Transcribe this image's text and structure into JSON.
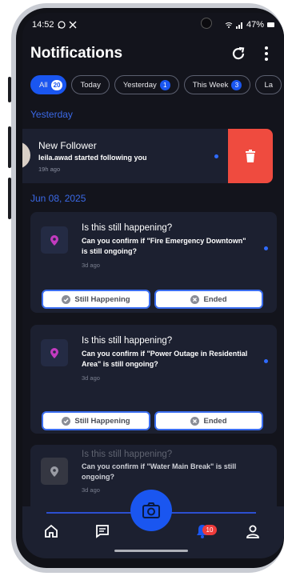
{
  "status_bar": {
    "time": "14:52",
    "right_text": "47%"
  },
  "header": {
    "title": "Notifications"
  },
  "filters": [
    {
      "label": "All",
      "count": "20"
    },
    {
      "label": "Today",
      "count": ""
    },
    {
      "label": "Yesterday",
      "count": "1"
    },
    {
      "label": "This Week",
      "count": "3"
    },
    {
      "label": "La",
      "count": ""
    }
  ],
  "sections": {
    "yesterday": "Yesterday",
    "date": "Jun 08, 2025"
  },
  "follower": {
    "title": "New Follower",
    "message": "leila.awad started following you",
    "time": "19h ago"
  },
  "cards": [
    {
      "title": "Is this still happening?",
      "message": "Can you confirm if \"Fire Emergency Downtown\" is still ongoing?",
      "time": "3d ago",
      "still_label": "Still Happening",
      "ended_label": "Ended"
    },
    {
      "title": "Is this still happening?",
      "message": "Can you confirm if \"Power Outage in Residential Area\" is still ongoing?",
      "time": "3d ago",
      "still_label": "Still Happening",
      "ended_label": "Ended"
    },
    {
      "title": "Is this still happening?",
      "message": "Can you confirm if \"Water Main Break\" is still ongoing?",
      "time": "3d ago"
    }
  ],
  "bottom_nav": {
    "notification_count": "10"
  },
  "colors": {
    "accent": "#1a56f0",
    "background": "#13141c",
    "card": "#1c2030",
    "delete": "#ef4b3f",
    "location_pin": "#c23bbf",
    "section_text": "#3b69e6"
  },
  "icons": [
    "whatsapp-icon",
    "x-logo-icon",
    "wifi-icon",
    "signal-icon",
    "battery-icon",
    "refresh-icon",
    "more-vertical-icon",
    "trash-icon",
    "location-pin-icon",
    "check-circle-icon",
    "x-circle-icon",
    "home-icon",
    "feed-icon",
    "camera-icon",
    "bell-icon",
    "user-icon"
  ]
}
